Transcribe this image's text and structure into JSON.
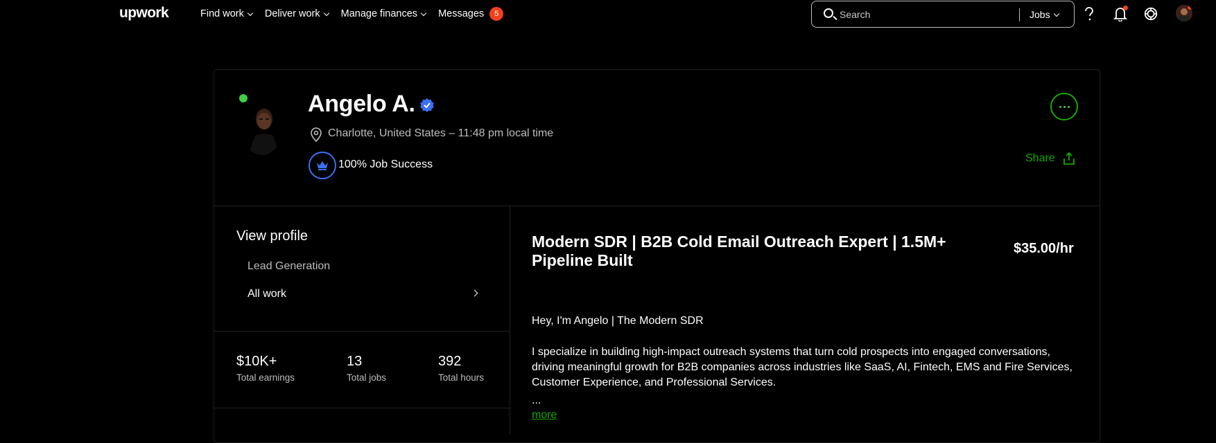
{
  "nav": {
    "logo": "upwork",
    "links": [
      {
        "label": "Find work"
      },
      {
        "label": "Deliver work"
      },
      {
        "label": "Manage finances"
      },
      {
        "label": "Messages",
        "badge": "5"
      }
    ],
    "search": {
      "placeholder": "Search",
      "scope": "Jobs"
    },
    "icons": [
      "help-icon",
      "notifications-icon",
      "apps-icon",
      "user-avatar"
    ]
  },
  "profile": {
    "name": "Angelo A.",
    "location": "Charlotte, United States – 11:48 pm local time",
    "job_success": "100% Job Success",
    "share_label": "Share"
  },
  "sidebar": {
    "title": "View profile",
    "items": [
      {
        "label": "Lead Generation"
      },
      {
        "label": "All work"
      }
    ]
  },
  "stats": [
    {
      "value": "$10K+",
      "label": "Total earnings"
    },
    {
      "value": "13",
      "label": "Total jobs"
    },
    {
      "value": "392",
      "label": "Total hours"
    }
  ],
  "main": {
    "headline": "Modern SDR | B2B Cold Email Outreach Expert | 1.5M+ Pipeline Built",
    "rate": "$35.00/hr",
    "greeting": "Hey, I'm Angelo | The Modern SDR",
    "paragraph": "I specialize in building high-impact outreach systems that turn cold prospects into engaged conversations, driving meaningful growth for B2B companies across industries like SaaS, AI, Fintech, EMS and Fire Services, Customer Experience, and Professional Services.",
    "ellipsis": "...",
    "more_label": "more"
  },
  "colors": {
    "accent_green": "#14a800",
    "badge_red": "#f1411c",
    "verified_blue": "#3b6ff5"
  }
}
